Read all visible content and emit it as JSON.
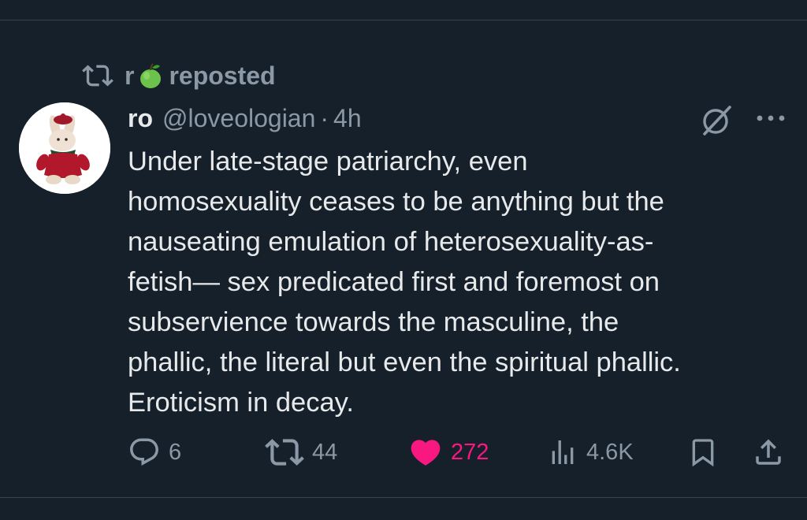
{
  "repost": {
    "user": "r",
    "label": "reposted",
    "emoji_icon": "green-apple-icon"
  },
  "tweet": {
    "display_name": "ro",
    "handle": "@loveologian",
    "separator": "·",
    "time": "4h",
    "text": "Under late-stage patriarchy, even\nhomosexuality ceases to be anything but the\nnauseating emulation of heterosexuality-as-\nfetish— sex predicated first and foremost on\nsubservience towards the masculine, the\nphallic, the literal but even the spiritual phallic.\nEroticism in decay."
  },
  "actions": {
    "replies": "6",
    "reposts": "44",
    "likes": "272",
    "views": "4.6K"
  },
  "colors": {
    "background": "#15202b",
    "text": "#e7e9ea",
    "muted": "#8b98a5",
    "like": "#f91880",
    "divider": "#38444d"
  }
}
